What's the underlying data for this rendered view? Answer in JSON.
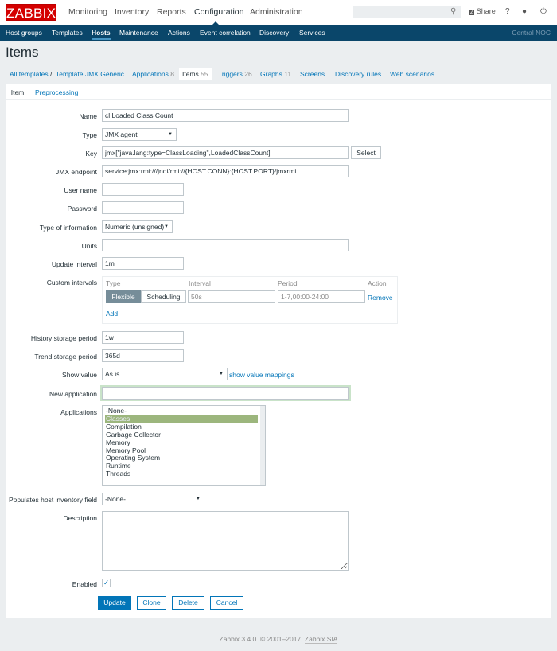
{
  "header": {
    "logo": "ZABBIX",
    "nav": [
      "Monitoring",
      "Inventory",
      "Reports",
      "Configuration",
      "Administration"
    ],
    "share": "Share",
    "help": "?",
    "search_value": ""
  },
  "subnav": {
    "items": [
      "Host groups",
      "Templates",
      "Hosts",
      "Maintenance",
      "Actions",
      "Event correlation",
      "Discovery",
      "Services"
    ],
    "right": "Central NOC"
  },
  "page_title": "Items",
  "breadcrumb": {
    "all": "All templates",
    "sep": "/",
    "template": "Template JMX Generic",
    "tabs": [
      {
        "label": "Applications",
        "count": "8"
      },
      {
        "label": "Items",
        "count": "55"
      },
      {
        "label": "Triggers",
        "count": "26"
      },
      {
        "label": "Graphs",
        "count": "11"
      },
      {
        "label": "Screens",
        "count": ""
      },
      {
        "label": "Discovery rules",
        "count": ""
      },
      {
        "label": "Web scenarios",
        "count": ""
      }
    ]
  },
  "form_tabs": [
    "Item",
    "Preprocessing"
  ],
  "form": {
    "name": {
      "label": "Name",
      "value": "cl Loaded Class Count"
    },
    "type": {
      "label": "Type",
      "value": "JMX agent"
    },
    "key": {
      "label": "Key",
      "value": "jmx[\"java.lang:type=ClassLoading\",LoadedClassCount]",
      "button": "Select"
    },
    "jmx": {
      "label": "JMX endpoint",
      "value": "service:jmx:rmi:///jndi/rmi://{HOST.CONN}:{HOST.PORT}/jmxrmi"
    },
    "user": {
      "label": "User name",
      "value": ""
    },
    "password": {
      "label": "Password",
      "value": ""
    },
    "type_info": {
      "label": "Type of information",
      "value": "Numeric (unsigned)"
    },
    "units": {
      "label": "Units",
      "value": ""
    },
    "update": {
      "label": "Update interval",
      "value": "1m"
    },
    "custom": {
      "label": "Custom intervals",
      "headers": [
        "Type",
        "Interval",
        "Period",
        "Action"
      ],
      "flexible": "Flexible",
      "scheduling": "Scheduling",
      "interval": "50s",
      "period": "1-7,00:00-24:00",
      "remove": "Remove",
      "add": "Add"
    },
    "history": {
      "label": "History storage period",
      "value": "1w"
    },
    "trend": {
      "label": "Trend storage period",
      "value": "365d"
    },
    "show": {
      "label": "Show value",
      "value": "As is",
      "link": "show value mappings"
    },
    "new_app": {
      "label": "New application",
      "value": ""
    },
    "apps": {
      "label": "Applications",
      "options": [
        "-None-",
        "Classes",
        "Compilation",
        "Garbage Collector",
        "Memory",
        "Memory Pool",
        "Operating System",
        "Runtime",
        "Threads"
      ],
      "selected": "Classes"
    },
    "inventory": {
      "label": "Populates host inventory field",
      "value": "-None-"
    },
    "description": {
      "label": "Description",
      "value": ""
    },
    "enabled": {
      "label": "Enabled",
      "checked": true
    }
  },
  "buttons": {
    "update": "Update",
    "clone": "Clone",
    "delete": "Delete",
    "cancel": "Cancel"
  },
  "footer": {
    "text": "Zabbix 3.4.0. © 2001–2017, ",
    "link": "Zabbix SIA"
  },
  "colors": {
    "brand": "#d40000",
    "subnav": "#0a466a",
    "link": "#0275b8",
    "selected": "#9cb67d"
  }
}
